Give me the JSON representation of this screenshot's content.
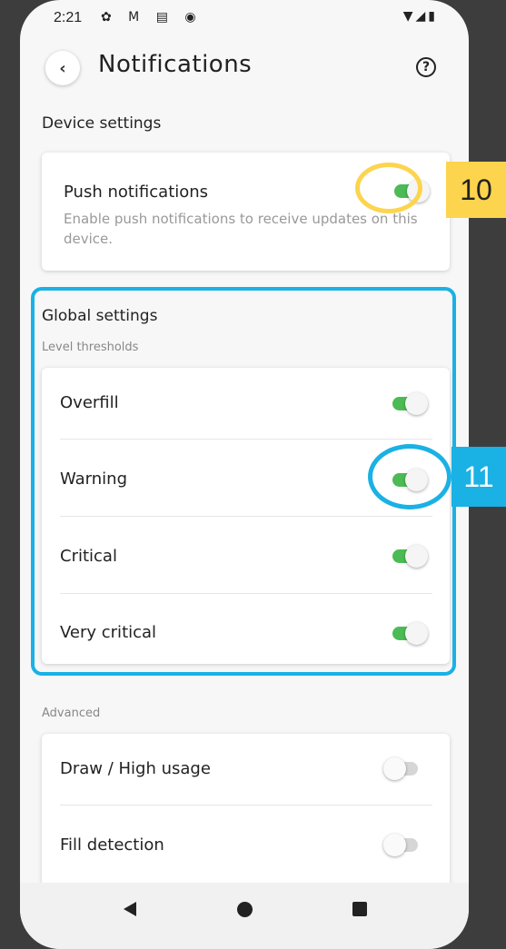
{
  "status_bar": {
    "time": "2:21",
    "left_icons": "✿ M ▤ ◉",
    "right_icons": "▼◢▮"
  },
  "header": {
    "title": "Notifications",
    "back_icon": "‹",
    "help_icon": "?"
  },
  "device_settings": {
    "title": "Device settings",
    "push": {
      "label": "Push notifications",
      "description": "Enable push notifications to receive updates on this device.",
      "enabled": true
    }
  },
  "global_settings": {
    "title": "Global settings",
    "subtitle": "Level thresholds",
    "items": [
      {
        "label": "Overfill",
        "enabled": true
      },
      {
        "label": "Warning",
        "enabled": true
      },
      {
        "label": "Critical",
        "enabled": true
      },
      {
        "label": "Very critical",
        "enabled": true
      }
    ]
  },
  "advanced": {
    "subtitle": "Advanced",
    "items": [
      {
        "label": "Draw / High usage",
        "enabled": false
      },
      {
        "label": "Fill detection",
        "enabled": false
      }
    ]
  },
  "callouts": {
    "push": "10",
    "warning": "11"
  },
  "colors": {
    "toggle_on": "#4cbb55",
    "callout_yellow": "#fdd44e",
    "callout_blue": "#1ab1e5",
    "background": "#3d3d3d"
  }
}
